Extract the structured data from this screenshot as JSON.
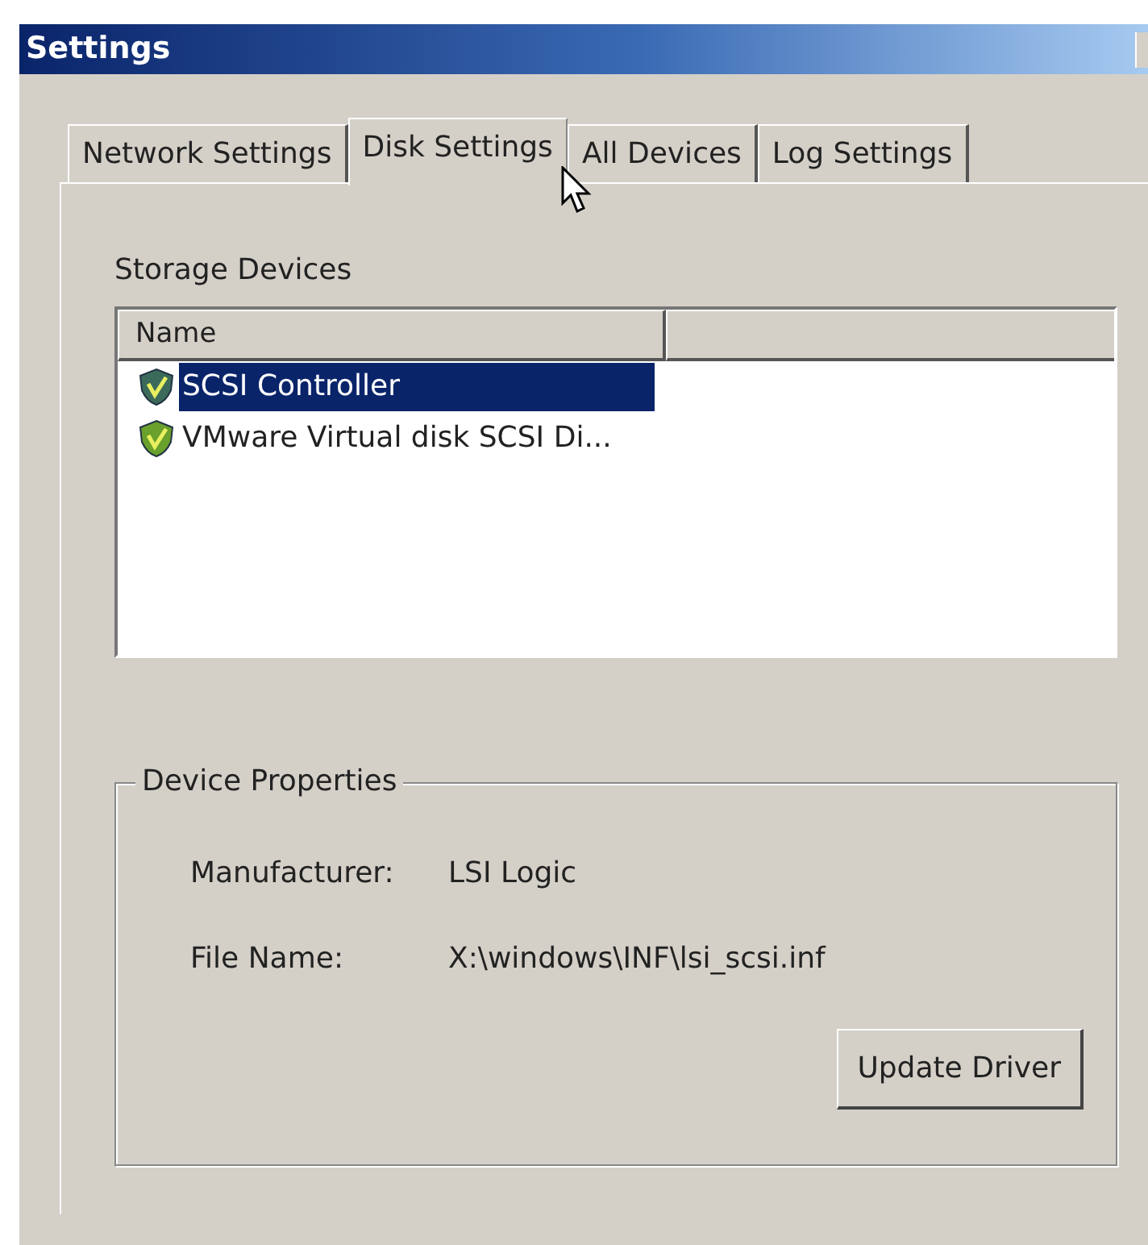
{
  "window": {
    "title": "Settings"
  },
  "tabs": [
    {
      "label": "Network Settings",
      "selected": false
    },
    {
      "label": "Disk Settings",
      "selected": true
    },
    {
      "label": "All Devices",
      "selected": false
    },
    {
      "label": "Log Settings",
      "selected": false
    }
  ],
  "storage_devices": {
    "label": "Storage Devices",
    "columns": [
      "Name"
    ],
    "rows": [
      {
        "name": "SCSI Controller",
        "selected": true
      },
      {
        "name": "VMware Virtual disk SCSI Di...",
        "selected": false
      }
    ]
  },
  "device_properties": {
    "title": "Device Properties",
    "fields": [
      {
        "label": "Manufacturer:",
        "value": "LSI Logic"
      },
      {
        "label": "File Name:",
        "value": "X:\\windows\\INF\\lsi_scsi.inf"
      }
    ],
    "button": "Update Driver"
  }
}
